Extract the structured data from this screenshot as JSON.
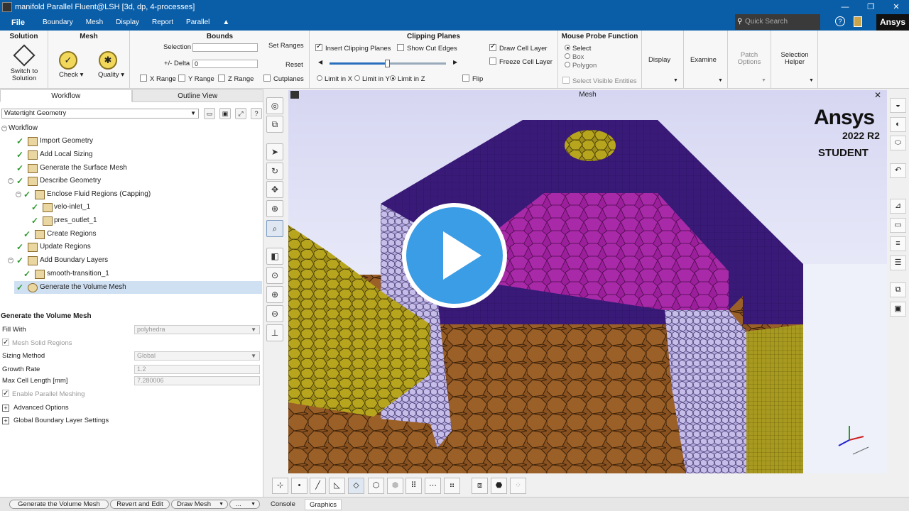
{
  "window": {
    "title": "manifold Parallel Fluent@LSH  [3d, dp, 4-processes]",
    "controls": [
      "—",
      "❐",
      "✕"
    ]
  },
  "menu": {
    "items": [
      "File",
      "Boundary",
      "Mesh",
      "Display",
      "Report",
      "Parallel"
    ],
    "collapse": "▲",
    "search_placeholder": "Quick Search",
    "help": "?",
    "brand": "Ansys"
  },
  "ribbon": {
    "solution": {
      "title": "Solution",
      "switch_label": "Switch to Solution"
    },
    "mesh": {
      "title": "Mesh",
      "check_label": "Check",
      "quality_label": "Quality"
    },
    "bounds": {
      "title": "Bounds",
      "selection_label": "Selection",
      "delta_label": "+/- Delta",
      "delta_value": "0",
      "x_range": "X Range",
      "y_range": "Y Range",
      "z_range": "Z Range"
    },
    "set_ranges": "Set Ranges",
    "reset": "Reset",
    "cutplanes": "Cutplanes",
    "clipping": {
      "title": "Clipping Planes",
      "insert": "Insert Clipping Planes",
      "show_cut_edges": "Show Cut Edges",
      "limit_x": "Limit in X",
      "limit_y": "Limit in Y",
      "limit_z": "Limit in Z",
      "flip": "Flip",
      "draw_cell_layer": "Draw Cell Layer",
      "freeze_cell_layer": "Freeze Cell Layer",
      "slider_position": 0.5
    },
    "probe": {
      "title": "Mouse Probe Function",
      "options": [
        "Select",
        "Box",
        "Polygon"
      ],
      "select_visible": "Select Visible Entities"
    },
    "display": "Display",
    "examine": "Examine",
    "patch_options": "Patch Options",
    "selection_helper": "Selection Helper"
  },
  "panel": {
    "tabs": [
      "Workflow",
      "Outline View"
    ],
    "workflow_type": "Watertight Geometry",
    "tree": [
      {
        "label": "Workflow"
      },
      {
        "label": "Import Geometry"
      },
      {
        "label": "Add Local Sizing"
      },
      {
        "label": "Generate the Surface Mesh"
      },
      {
        "label": "Describe Geometry"
      },
      {
        "label": "Enclose Fluid Regions (Capping)"
      },
      {
        "label": "velo-inlet_1"
      },
      {
        "label": "pres_outlet_1"
      },
      {
        "label": "Create Regions"
      },
      {
        "label": "Update Regions"
      },
      {
        "label": "Add Boundary Layers"
      },
      {
        "label": "smooth-transition_1"
      },
      {
        "label": "Generate the Volume Mesh"
      }
    ],
    "section_title": "Generate the Volume Mesh",
    "props": {
      "fill_with_label": "Fill With",
      "fill_with_value": "polyhedra",
      "mesh_solid_label": "Mesh Solid Regions",
      "sizing_method_label": "Sizing Method",
      "sizing_method_value": "Global",
      "growth_rate_label": "Growth Rate",
      "growth_rate_value": "1.2",
      "max_cell_label": "Max Cell Length [mm]",
      "max_cell_value": "7.280006",
      "parallel_label": "Enable Parallel Meshing",
      "advanced_label": "Advanced Options",
      "global_bl_label": "Global Boundary Layer Settings"
    }
  },
  "bottom": {
    "primary_button": "Generate the Volume Mesh",
    "revert_button": "Revert and Edit",
    "draw_mesh_button": "Draw Mesh",
    "more_button": "...",
    "tabs": [
      "Console",
      "Graphics"
    ]
  },
  "graphics": {
    "title": "Mesh",
    "watermark_brand": "Ansys",
    "watermark_version": "2022 R2",
    "watermark_edition": "STUDENT"
  },
  "colors": {
    "accent": "#0a5ea8",
    "play": "#3b9de6",
    "top_face": "#3a1a78",
    "inner_face": "#9b1f9b",
    "poly_cells": "#8a5220",
    "layer_cells": "#b4a8e0",
    "yellow_cells": "#b8a51e"
  }
}
